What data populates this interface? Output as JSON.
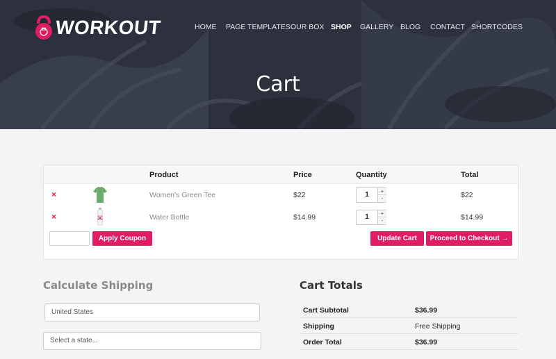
{
  "brand": {
    "name": "WORKOUT",
    "accent": "#e01c62",
    "logo_icon": "kettlebell-icon",
    "logo_badge": "20"
  },
  "nav": [
    {
      "label": "HOME",
      "active": false
    },
    {
      "label": "PAGE TEMPLATES",
      "active": false
    },
    {
      "label": "OUR BOX",
      "active": false
    },
    {
      "label": "SHOP",
      "active": true
    },
    {
      "label": "GALLERY",
      "active": false
    },
    {
      "label": "BLOG",
      "active": false
    },
    {
      "label": "CONTACT",
      "active": false
    },
    {
      "label": "SHORTCODES",
      "active": false
    }
  ],
  "page_title": "Cart",
  "cart": {
    "columns": {
      "product": "Product",
      "price": "Price",
      "quantity": "Quantity",
      "total": "Total"
    },
    "items": [
      {
        "remove": "×",
        "thumb": "green-tee-thumbnail",
        "name": "Women’s Green Tee",
        "price": "$22",
        "quantity": "1",
        "total": "$22"
      },
      {
        "remove": "×",
        "thumb": "water-bottle-thumbnail",
        "name": "Water Bottle",
        "price": "$14.99",
        "quantity": "1",
        "total": "$14.99"
      }
    ],
    "stepper_up": "+",
    "stepper_down": "-",
    "coupon_placeholder": "",
    "apply_coupon": "Apply Coupon",
    "update_cart": "Update Cart",
    "checkout": "Proceed to Checkout →"
  },
  "shipping": {
    "title": "Calculate Shipping",
    "country": "United States",
    "state_placeholder": "Select a state..."
  },
  "totals": {
    "title": "Cart Totals",
    "rows": [
      {
        "label": "Cart Subtotal",
        "value": "$36.99",
        "bold": true
      },
      {
        "label": "Shipping",
        "value": "Free Shipping",
        "bold": false
      },
      {
        "label": "Order Total",
        "value": "$36.99",
        "bold": true
      }
    ]
  }
}
